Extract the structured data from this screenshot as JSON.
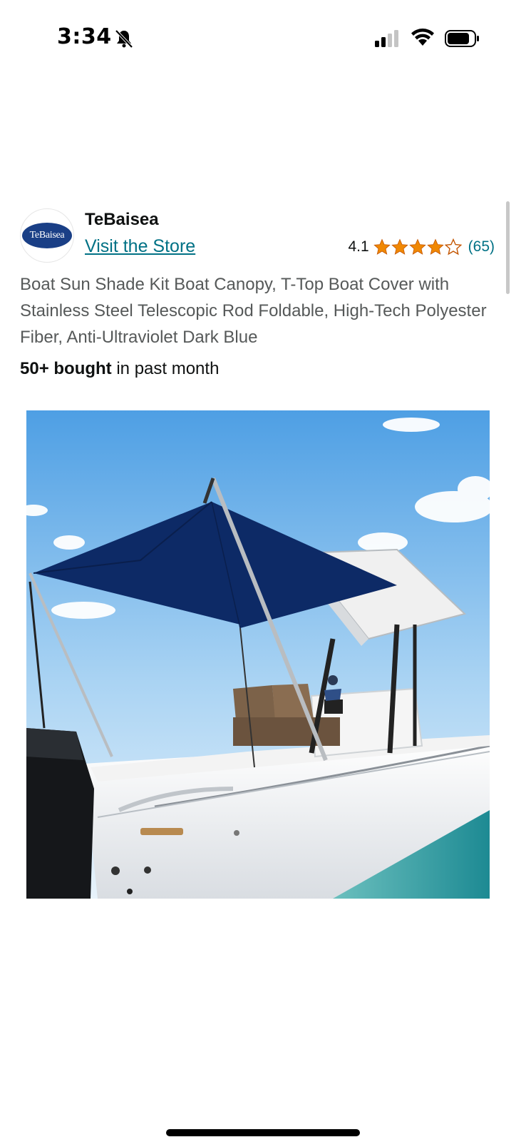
{
  "status_bar": {
    "time": "3:34",
    "icons": [
      "bell-slash-icon",
      "signal-icon",
      "wifi-icon",
      "battery-icon"
    ]
  },
  "store": {
    "logo_text": "TeBaisea",
    "name": "TeBaisea",
    "link_label": "Visit the Store",
    "logo_color": "#1a3f86"
  },
  "rating": {
    "value": "4.1",
    "stars": 4.1,
    "count": "(65)",
    "star_color": "#f08804"
  },
  "product": {
    "title": "Boat Sun Shade Kit Boat Canopy, T-Top Boat Cover with Stainless Steel Telescopic Rod Foldable, High-Tech Polyester Fiber, Anti-Ultraviolet Dark Blue",
    "bought_count": "50+ bought",
    "bought_suffix": " in past month",
    "image_description_icon": "product-photo",
    "canopy_color": "#0d2a66",
    "sky_color": "#5aa6e6",
    "water_color": "#1f8f95"
  },
  "colors": {
    "link": "#007185",
    "text_secondary": "#565959",
    "text_primary": "#0f1111"
  }
}
